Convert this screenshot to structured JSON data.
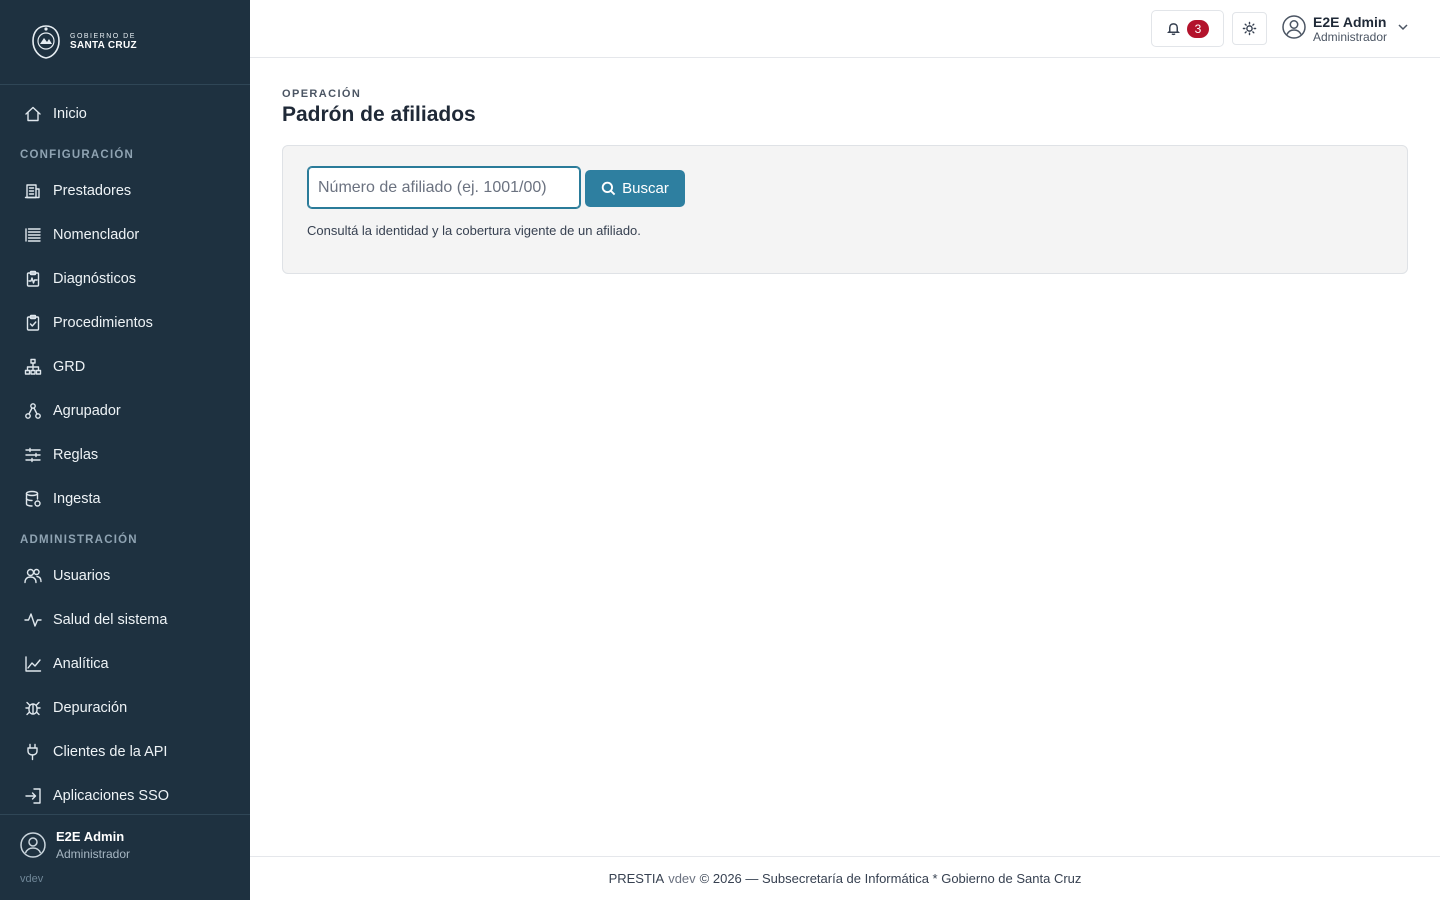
{
  "brand": {
    "line1": "GOBIERNO DE",
    "line2": "SANTA CRUZ"
  },
  "sidebar": {
    "items": [
      {
        "type": "item",
        "label": "Inicio",
        "icon": "home-icon"
      },
      {
        "type": "section",
        "label": "CONFIGURACIÓN"
      },
      {
        "type": "item",
        "label": "Prestadores",
        "icon": "building-icon"
      },
      {
        "type": "item",
        "label": "Nomenclador",
        "icon": "list-icon"
      },
      {
        "type": "item",
        "label": "Diagnósticos",
        "icon": "clipboard-pulse-icon"
      },
      {
        "type": "item",
        "label": "Procedimientos",
        "icon": "clipboard-check-icon"
      },
      {
        "type": "item",
        "label": "GRD",
        "icon": "hierarchy-icon"
      },
      {
        "type": "item",
        "label": "Agrupador",
        "icon": "network-icon"
      },
      {
        "type": "item",
        "label": "Reglas",
        "icon": "sliders-icon"
      },
      {
        "type": "item",
        "label": "Ingesta",
        "icon": "database-icon"
      },
      {
        "type": "section",
        "label": "ADMINISTRACIÓN"
      },
      {
        "type": "item",
        "label": "Usuarios",
        "icon": "users-icon"
      },
      {
        "type": "item",
        "label": "Salud del sistema",
        "icon": "activity-icon"
      },
      {
        "type": "item",
        "label": "Analítica",
        "icon": "chart-line-icon"
      },
      {
        "type": "item",
        "label": "Depuración",
        "icon": "bug-icon"
      },
      {
        "type": "item",
        "label": "Clientes de la API",
        "icon": "plug-icon"
      },
      {
        "type": "item",
        "label": "Aplicaciones SSO",
        "icon": "sign-in-icon"
      }
    ],
    "user": {
      "name": "E2E Admin",
      "role": "Administrador",
      "version": "vdev"
    }
  },
  "topbar": {
    "notifications_count": "3",
    "user": {
      "name": "E2E Admin",
      "role": "Administrador"
    }
  },
  "main": {
    "eyebrow": "OPERACIÓN",
    "title": "Padrón de afiliados",
    "search": {
      "placeholder": "Número de afiliado (ej. 1001/00)",
      "value": "",
      "button_label": "Buscar",
      "help": "Consultá la identidad y la cobertura vigente de un afiliado."
    }
  },
  "footer": {
    "app": "PRESTIA",
    "version": "vdev",
    "rest": "© 2026 — Subsecretaría de Informática * Gobierno de Santa Cruz"
  },
  "colors": {
    "sidebar_bg": "#1e3140",
    "accent": "#2e7fa0",
    "badge": "#b3132c"
  }
}
